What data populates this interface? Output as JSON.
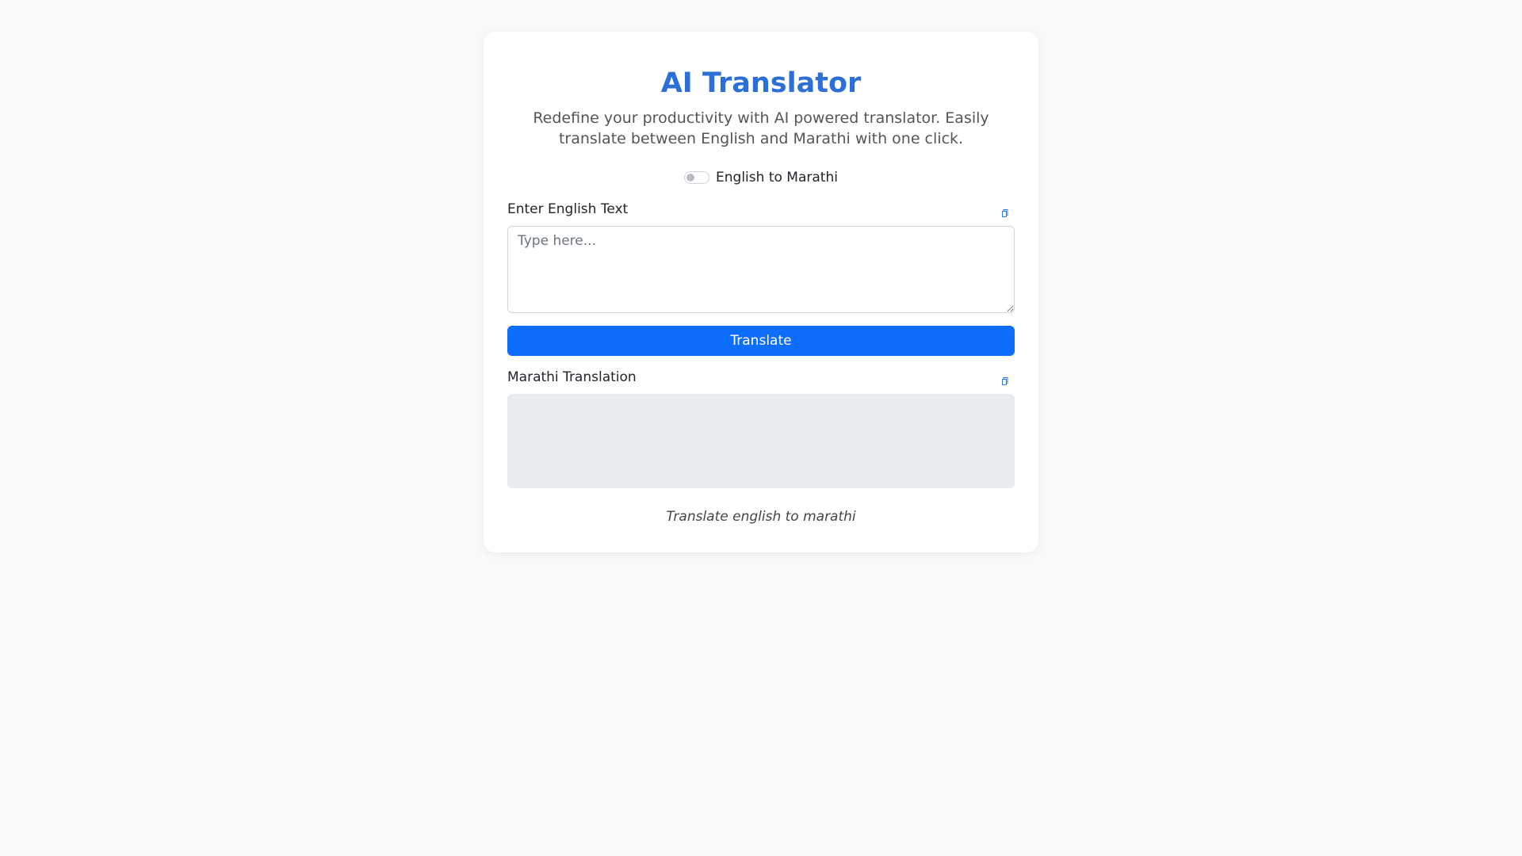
{
  "header": {
    "title": "AI Translator",
    "subtitle": "Redefine your productivity with AI powered translator. Easily translate between English and Marathi with one click."
  },
  "toggle": {
    "label": "English to Marathi",
    "checked": false
  },
  "input": {
    "label": "Enter English Text",
    "placeholder": "Type here...",
    "value": ""
  },
  "translate_button": {
    "label": "Translate"
  },
  "output": {
    "label": "Marathi Translation",
    "value": ""
  },
  "footer": {
    "note": "Translate english to marathi"
  },
  "icons": {
    "input_copy": "copy-icon",
    "output_copy": "copy-icon"
  },
  "colors": {
    "accent": "#2c6fd6",
    "button": "#0d6efd",
    "background": "#f8f9fa",
    "output_bg": "#e9ecef"
  }
}
